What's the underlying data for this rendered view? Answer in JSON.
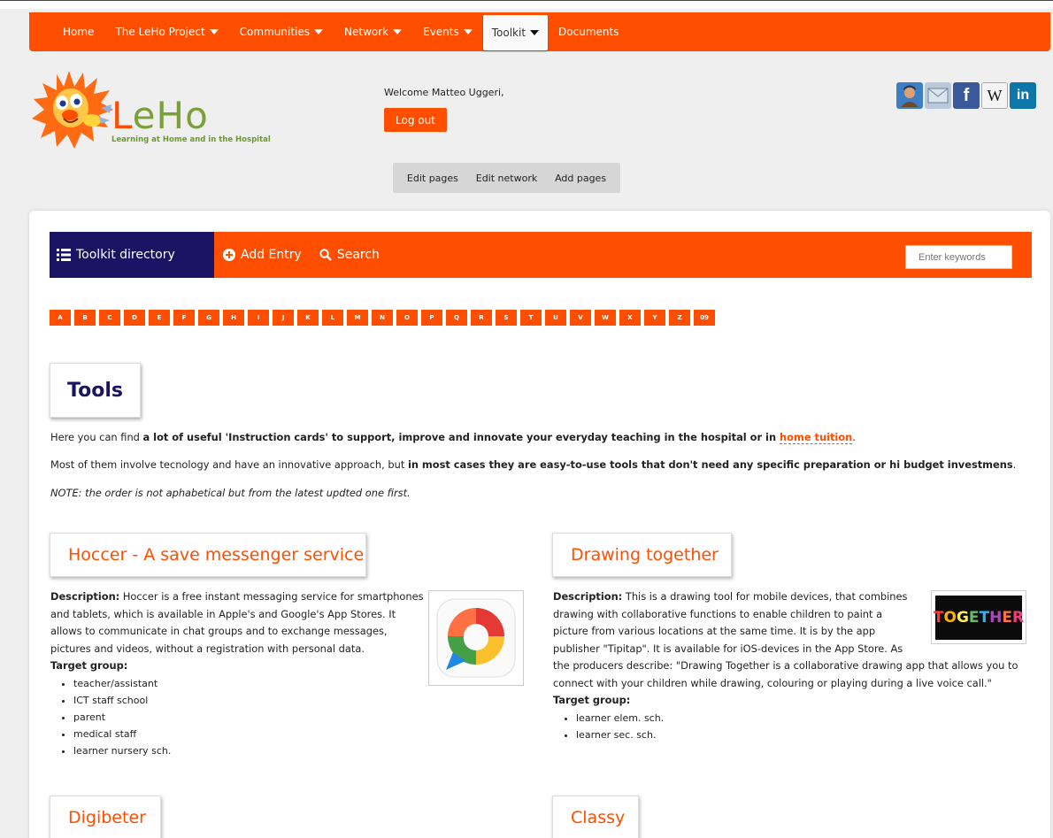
{
  "nav": {
    "items": [
      {
        "label": "Home",
        "caret": false,
        "active": false
      },
      {
        "label": "The LeHo Project",
        "caret": true,
        "active": false
      },
      {
        "label": "Communities",
        "caret": true,
        "active": false
      },
      {
        "label": "Network",
        "caret": true,
        "active": false
      },
      {
        "label": "Events",
        "caret": true,
        "active": false
      },
      {
        "label": "Toolkit",
        "caret": true,
        "active": true
      },
      {
        "label": "Documents",
        "caret": false,
        "active": false
      }
    ]
  },
  "header": {
    "logo_word_first": "L",
    "logo_word_rest": "eHo",
    "logo_tagline": "Learning at Home and in the Hospital",
    "welcome": "Welcome Matteo Uggeri,",
    "logout_label": "Log out",
    "social_icons": [
      "user-avatar-icon",
      "email-icon",
      "facebook-icon",
      "wikipedia-icon",
      "linkedin-icon"
    ],
    "social_glyphs": {
      "facebook": "f",
      "wikipedia": "W",
      "linkedin": "in"
    },
    "edit_links": [
      "Edit pages",
      "Edit network",
      "Add pages"
    ]
  },
  "toolbar": {
    "directory_label": "Toolkit directory",
    "add_label": "Add Entry",
    "search_label": "Search",
    "search_placeholder": "Enter keywords"
  },
  "alphabet": [
    "A",
    "B",
    "C",
    "D",
    "E",
    "F",
    "G",
    "H",
    "I",
    "J",
    "K",
    "L",
    "M",
    "N",
    "O",
    "P",
    "Q",
    "R",
    "S",
    "T",
    "U",
    "V",
    "W",
    "X",
    "Y",
    "Z",
    "09"
  ],
  "section": {
    "title": "Tools",
    "intro1_pre": "Here you can find ",
    "intro1_bold": "a lot of useful 'Instruction cards' to support, improve and innovate your everyday teaching in the hospital or in ",
    "intro1_link": "home tuition",
    "intro1_post": ".",
    "intro2_pre": "Most of them involve tecnology and have an innovative approach, but ",
    "intro2_bold": "in most cases they are easy-to-use tools that don't need any specific preparation or hi budget investmens",
    "intro2_post": ".",
    "note": "NOTE: the order is not aphabetical but from the latest updted one first."
  },
  "entries": [
    {
      "title": "Hoccer - A save messenger service",
      "desc_label": "Description:",
      "desc_lines": [
        " Hoccer is a free instant messaging service for smartphones",
        "and tablets, which is available in Apple's and Google's App Stores. It",
        "allows to communicate in chat groups and to exchange messages,",
        "pictures and videos, without a registration with personal data."
      ],
      "target_label": "Target group:",
      "targets": [
        "teacher/assistant",
        "ICT staff school",
        "parent",
        "medical staff",
        "learner nursery sch."
      ]
    },
    {
      "title": "Drawing together",
      "desc_label": "Description:",
      "desc_lines": [
        " This is a drawing tool for mobile devices, that combines",
        "drawing with collaborative functions to enable children to paint a",
        "picture from various locations at the same time. It is by the app",
        "publisher \"Tipitap\". It is available for iOS-devices in the App Store. As",
        "the producers describe: \"Drawing Together is a collaborative drawing app that allows you to",
        "connect with your children while drawing, colouring or playing during a live voice call.\""
      ],
      "target_label": "Target group:",
      "targets": [
        "learner elem. sch.",
        "learner sec. sch."
      ],
      "thumb_text": "TOGETHER"
    },
    {
      "title": "Digibeter"
    },
    {
      "title": "Classy"
    }
  ],
  "colors": {
    "brand": "#ff4e00",
    "navy": "#1b1464",
    "green": "#7ba03a"
  }
}
